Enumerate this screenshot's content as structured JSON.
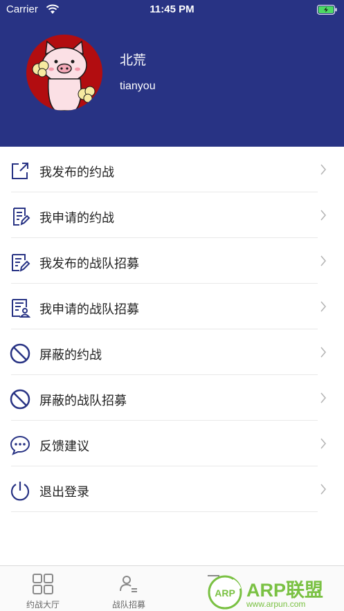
{
  "status_bar": {
    "carrier": "Carrier",
    "time": "11:45 PM"
  },
  "profile": {
    "name": "北荒",
    "username": "tianyou"
  },
  "menu": {
    "items": [
      {
        "label": "我发布的约战",
        "icon": "external-link-icon"
      },
      {
        "label": "我申请的约战",
        "icon": "document-edit-icon"
      },
      {
        "label": "我发布的战队招募",
        "icon": "document-pen-icon"
      },
      {
        "label": "我申请的战队招募",
        "icon": "document-user-icon"
      },
      {
        "label": "屏蔽的约战",
        "icon": "block-icon"
      },
      {
        "label": "屏蔽的战队招募",
        "icon": "block-icon"
      },
      {
        "label": "反馈建议",
        "icon": "chat-bubble-icon"
      },
      {
        "label": "退出登录",
        "icon": "power-icon"
      }
    ]
  },
  "tabbar": {
    "tabs": [
      {
        "label": "约战大厅",
        "icon": "grid-icon"
      },
      {
        "label": "战队招募",
        "icon": "user-list-icon"
      }
    ]
  },
  "watermark": {
    "brand": "ARP联盟",
    "badge": "ARP",
    "url": "www.arpun.com"
  },
  "colors": {
    "header_bg": "#283384",
    "icon_blue": "#283384",
    "watermark_green": "#7ac143"
  }
}
